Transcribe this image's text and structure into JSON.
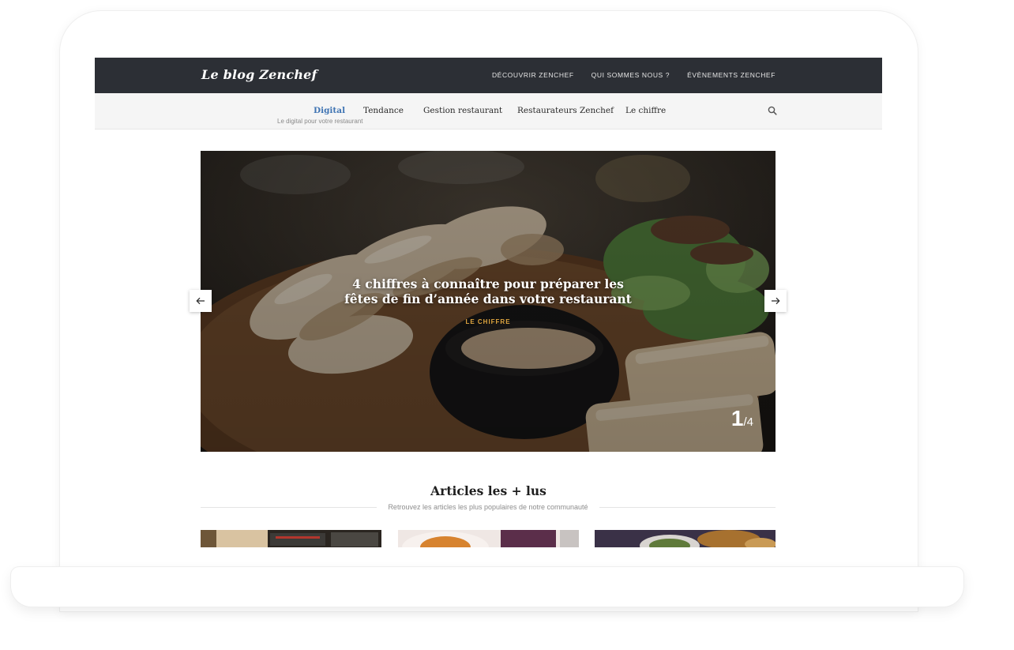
{
  "blog": {
    "logo": "Le blog Zenchef",
    "top_nav": [
      "DÉCOUVRIR ZENCHEF",
      "QUI SOMMES NOUS ?",
      "ÉVÈNEMENTS ZENCHEF"
    ]
  },
  "categories": {
    "items": [
      "Digital",
      "Tendance",
      "Gestion restaurant",
      "Restaurateurs Zenchef",
      "Le chiffre"
    ],
    "active_subtitle": "Le digital pour votre restaurant"
  },
  "slider": {
    "title": "4 chiffres à connaître pour préparer les fêtes de fin d’année dans votre restaurant",
    "category": "LE CHIFFRE",
    "current": "1",
    "total": "/4"
  },
  "popular": {
    "title": "Articles les + lus",
    "subtitle": "Retrouvez les articles les plus populaires de notre communauté"
  },
  "colors": {
    "topbar": "#2c2f35",
    "accent_link": "#3f74b3",
    "category_gold": "#e0a640"
  },
  "icons": [
    "search-icon",
    "arrow-left-icon",
    "arrow-right-icon"
  ]
}
